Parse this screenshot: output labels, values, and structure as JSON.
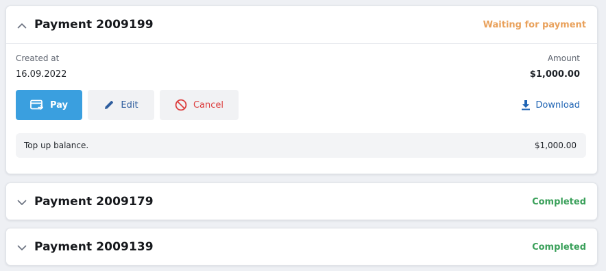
{
  "payments": [
    {
      "title": "Payment 2009199",
      "status": "Waiting for payment",
      "expanded": true,
      "created_label": "Created at",
      "created_value": "16.09.2022",
      "amount_label": "Amount",
      "amount_value": "$1,000.00",
      "actions": {
        "pay_label": "Pay",
        "edit_label": "Edit",
        "cancel_label": "Cancel",
        "download_label": "Download"
      },
      "line_item": {
        "description": "Top up balance.",
        "amount": "$1,000.00"
      }
    },
    {
      "title": "Payment 2009179",
      "status": "Completed",
      "expanded": false
    },
    {
      "title": "Payment 2009139",
      "status": "Completed",
      "expanded": false
    }
  ],
  "colors": {
    "waiting": "#e9a15b",
    "completed": "#3aa05a",
    "pay_button": "#3a9fdf",
    "edit_text": "#2f5e9e",
    "cancel_text": "#dc3c3c",
    "download_text": "#1f64b4"
  },
  "icons": {
    "expanded": "chevron-up-icon",
    "collapsed": "chevron-down-icon",
    "pay": "credit-card-icon",
    "edit": "pencil-icon",
    "cancel": "cancel-circle-icon",
    "download": "download-icon"
  }
}
